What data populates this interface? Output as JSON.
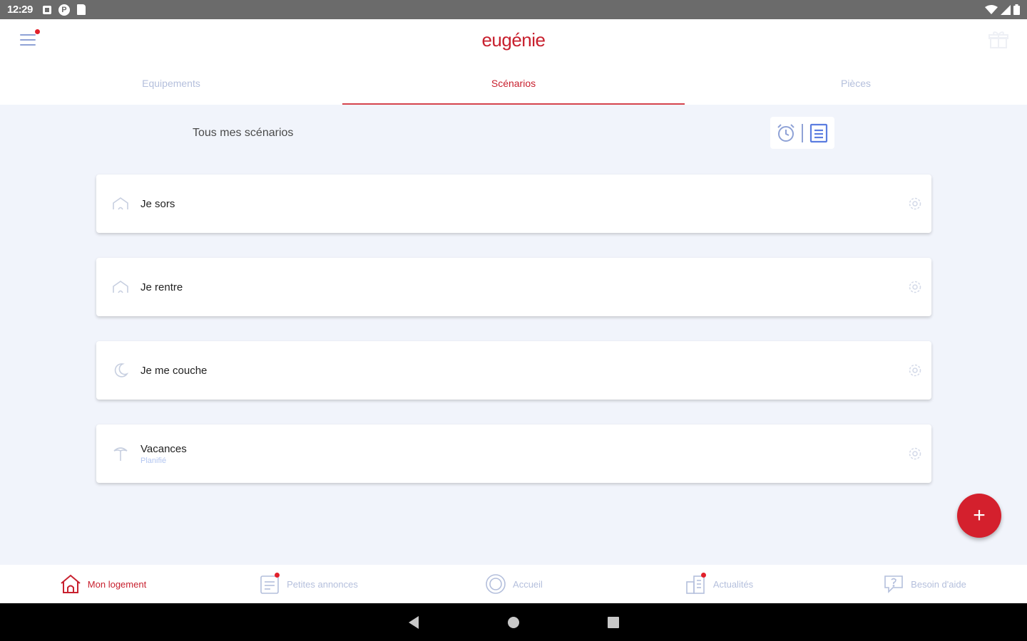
{
  "status_bar": {
    "time": "12:29",
    "app_icon_letter": "P"
  },
  "header": {
    "logo": "eugénie"
  },
  "tabs": [
    {
      "label": "Equipements",
      "active": false
    },
    {
      "label": "Scénarios",
      "active": true
    },
    {
      "label": "Pièces",
      "active": false
    }
  ],
  "content": {
    "section_title": "Tous mes scénarios"
  },
  "scenarios": [
    {
      "name": "Je sors",
      "subtitle": "",
      "icon": "house-outline-icon"
    },
    {
      "name": "Je rentre",
      "subtitle": "",
      "icon": "house-outline-icon"
    },
    {
      "name": "Je me couche",
      "subtitle": "",
      "icon": "moon-icon"
    },
    {
      "name": "Vacances",
      "subtitle": "Planifié",
      "icon": "palm-tree-icon"
    }
  ],
  "fab": {
    "label": "+"
  },
  "bottom_nav": [
    {
      "label": "Mon logement",
      "active": true,
      "icon": "home-icon",
      "badge": false
    },
    {
      "label": "Petites annonces",
      "active": false,
      "icon": "ads-board-icon",
      "badge": true
    },
    {
      "label": "Accueil",
      "active": false,
      "icon": "home-circle-icon",
      "badge": false
    },
    {
      "label": "Actualités",
      "active": false,
      "icon": "news-building-icon",
      "badge": true
    },
    {
      "label": "Besoin d'aide",
      "active": false,
      "icon": "help-bubble-icon",
      "badge": false
    }
  ],
  "colors": {
    "accent": "#c8202e",
    "muted_blue": "#8fa2d6",
    "background": "#f1f4fb",
    "fab": "#d4202d"
  }
}
